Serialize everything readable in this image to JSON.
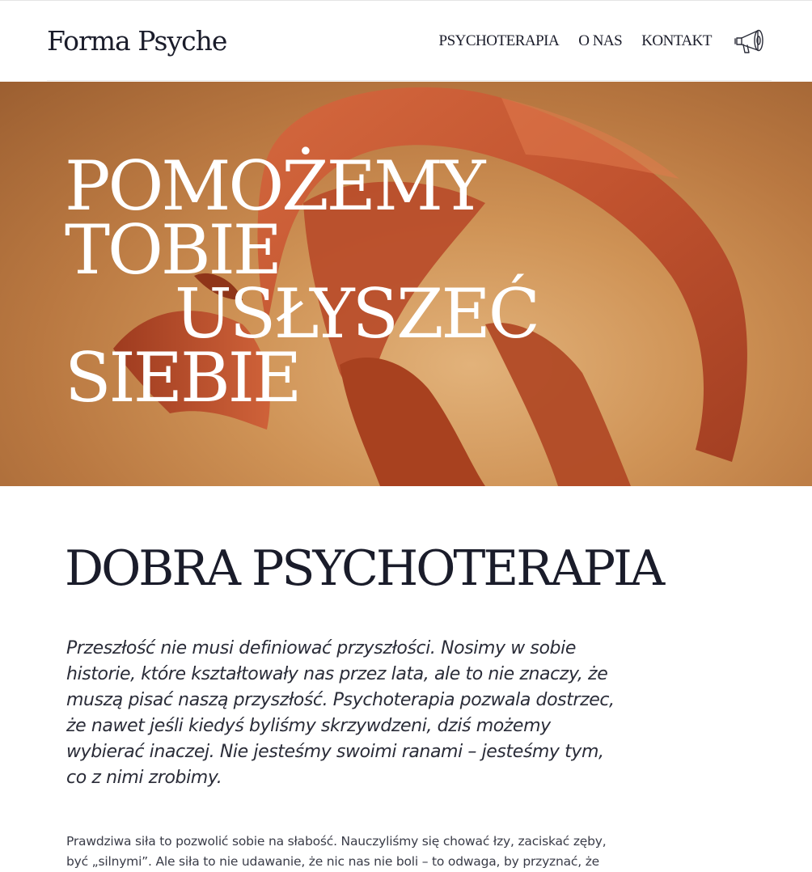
{
  "header": {
    "logo": "Forma Psyche",
    "nav": [
      "PSYCHOTERAPIA",
      "O NAS",
      "KONTAKT"
    ],
    "announce_icon": "megaphone-icon"
  },
  "hero": {
    "title_lines": [
      "POMOŻEMY",
      "TOBIE",
      "USŁYSZEĆ",
      "SIEBIE"
    ],
    "image": "orange-fabric-swirl"
  },
  "main": {
    "section_title": "DOBRA PSYCHOTERAPIA",
    "lead": "Przeszłość nie musi definiować przyszłości. Nosimy w sobie historie, które kształtowały nas przez lata, ale to nie znaczy, że muszą pisać naszą przyszłość. Psychoterapia pozwala dostrzec, że nawet jeśli kiedyś byliśmy skrzywdzeni, dziś możemy wybierać inaczej. Nie jesteśmy swoimi ranami – jesteśmy tym, co z nimi zrobimy.",
    "body": "Prawdziwa siła to pozwolić sobie na słabość. Nauczyliśmy się chować łzy, zaciskać zęby, być „silnymi”. Ale siła to nie udawanie, że nic nas nie boli – to odwaga, by przyznać, że"
  },
  "colors": {
    "text": "#1a1c2a",
    "fabric": "#c1532f",
    "hero_background": "#cf9356"
  }
}
